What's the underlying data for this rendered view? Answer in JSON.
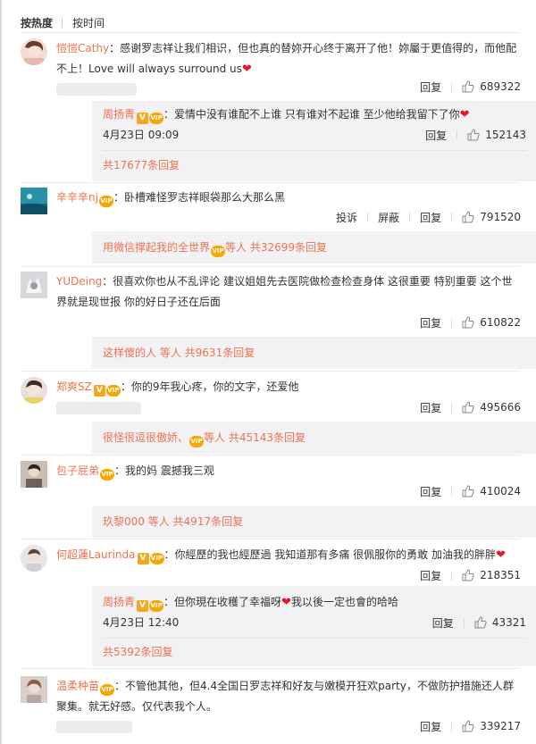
{
  "sort": {
    "hot": "按热度",
    "time": "按时间"
  },
  "labels": {
    "reply": "回复",
    "report": "投诉",
    "block": "屏蔽"
  },
  "comments": [
    {
      "user": "愷愷Cathy",
      "text": "：感谢罗志祥让我们相识，但也真的替妳开心终于离开了他！妳屬于更值得的，而他配不上！Love will always surround us",
      "likes": "689322",
      "reply": {
        "user": "周扬青",
        "text": "：爱情中没有谁配不上谁 只有谁对不起谁 至少他给我留下了你",
        "time": "4月23日 09:09",
        "likes": "152143"
      },
      "more": "共17677条回复"
    },
    {
      "user": "辛辛辛nj",
      "text": "：卧槽难怪罗志祥眼袋那么大那么黑",
      "likes": "791520",
      "more_prefix": "用微信撑起我的全世界",
      "more_suffix": "等人 共32699条回复"
    },
    {
      "user": "YUDeing",
      "text": "：很喜欢你也从不乱评论 建议姐姐先去医院做检查检查身体 这很重要 特别重要 这个世界就是现世报 你的好日子还在后面",
      "likes": "610822",
      "more_prefix": "这样傻的人",
      "more_suffix": "等人 共9631条回复"
    },
    {
      "user": "郑爽SZ",
      "text": "：你的9年我心疼，你的文字，还爱他",
      "likes": "495666",
      "more_prefix": "很怪很逗很傲娇、",
      "more_suffix": "等人 共45143条回复"
    },
    {
      "user": "包子屁弟",
      "text": "：我的妈 震撼我三观",
      "likes": "410024",
      "more_prefix": "玖黎000",
      "more_suffix": "等人 共4917条回复"
    },
    {
      "user": "何超蓮Laurinda",
      "text": "：你經歷的我也經歷過 我知道那有多痛 很佩服你的勇敢 加油我的胖胖",
      "likes": "218351",
      "reply": {
        "user": "周扬青",
        "text": "：但你現在收穫了幸福呀",
        "text2": "我以後一定也會的哈哈",
        "time": "4月23日 12:40",
        "likes": "43321"
      },
      "more": "共5392条回复"
    },
    {
      "user": "温柔种苗",
      "text": "：不管他其他，但4.4全国日罗志祥和好友与嫩模开狂欢party，不做防护措施还人群聚集。就无好感。仅代表我个人。",
      "likes": "339217"
    }
  ],
  "colors": {
    "link": "#eb7350",
    "reply_bg": "#f2f2f5",
    "heart": "#e6162d",
    "vip": "#f7a800"
  }
}
